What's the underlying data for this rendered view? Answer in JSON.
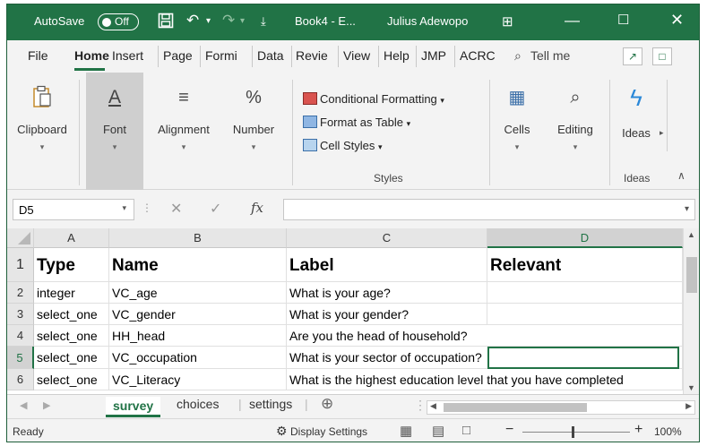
{
  "titlebar": {
    "autosave_label": "AutoSave",
    "autosave_state": "Off",
    "doc_title": "Book4 - E...",
    "user_name": "Julius Adewopo",
    "accent": "#217346"
  },
  "tabs": [
    {
      "label": "File"
    },
    {
      "label": "Home"
    },
    {
      "label": "Insert"
    },
    {
      "label": "Page"
    },
    {
      "label": "Formi"
    },
    {
      "label": "Data"
    },
    {
      "label": "Revie"
    },
    {
      "label": "View"
    },
    {
      "label": "Help"
    },
    {
      "label": "JMP"
    },
    {
      "label": "ACRC"
    },
    {
      "label": "Tell me"
    }
  ],
  "ribbon": {
    "clipboard": "Clipboard",
    "font": "Font",
    "alignment": "Alignment",
    "number": "Number",
    "conditional_formatting": "Conditional Formatting",
    "format_as_table": "Format as Table",
    "cell_styles": "Cell Styles",
    "styles_caption": "Styles",
    "cells": "Cells",
    "editing": "Editing",
    "ideas": "Ideas",
    "ideas_caption": "Ideas"
  },
  "formula_bar": {
    "name_box": "D5",
    "fx": "fx",
    "value": ""
  },
  "grid": {
    "columns": [
      "A",
      "B",
      "C",
      "D"
    ],
    "rows": [
      {
        "num": "1",
        "cells": [
          "Type",
          "Name",
          "Label",
          "Relevant"
        ]
      },
      {
        "num": "2",
        "cells": [
          "integer",
          "VC_age",
          "What is your age?",
          ""
        ]
      },
      {
        "num": "3",
        "cells": [
          "select_one",
          "VC_gender",
          "What is your gender?",
          ""
        ]
      },
      {
        "num": "4",
        "cells": [
          "select_one",
          "HH_head",
          "Are you the head of household?",
          ""
        ]
      },
      {
        "num": "5",
        "cells": [
          "select_one",
          "VC_occupation",
          "What is your sector of occupation?",
          ""
        ]
      },
      {
        "num": "6",
        "cells": [
          "select_one",
          "VC_Literacy",
          "What is the highest education level that you have completed",
          ""
        ]
      }
    ]
  },
  "sheets": [
    {
      "label": "survey"
    },
    {
      "label": "choices"
    },
    {
      "label": "settings"
    }
  ],
  "status": {
    "ready": "Ready",
    "display_settings": "Display Settings",
    "zoom": "100%"
  }
}
